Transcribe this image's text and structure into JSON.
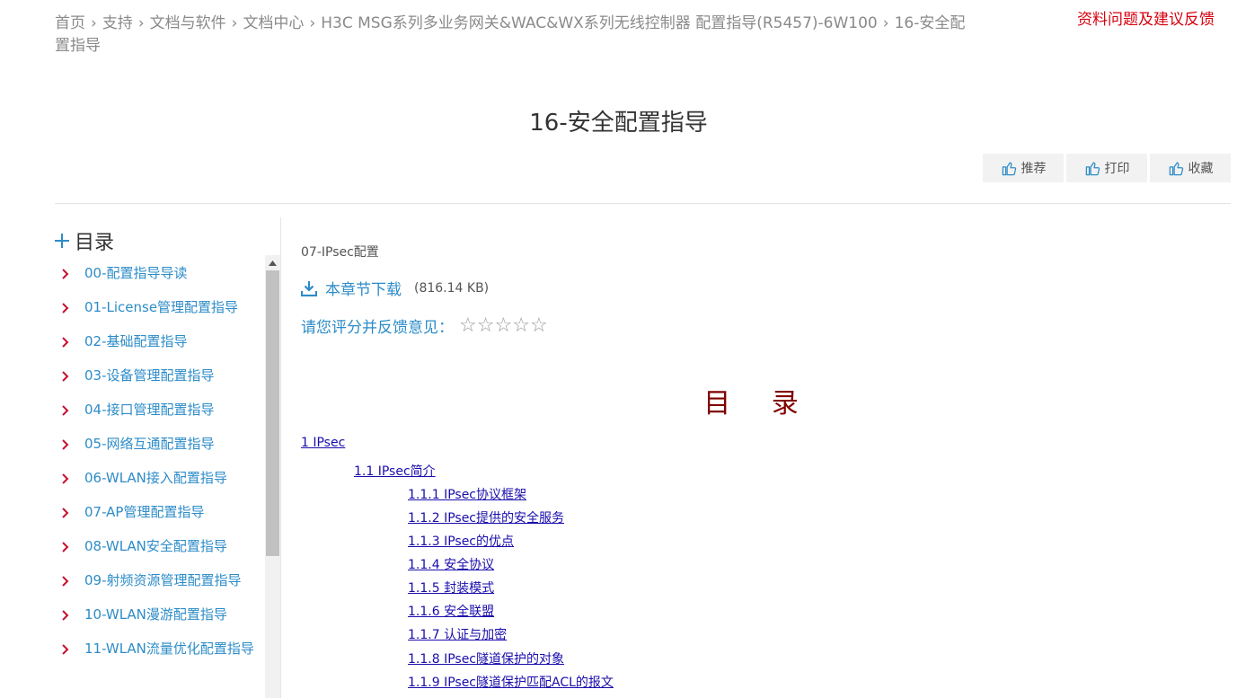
{
  "breadcrumb": {
    "items": [
      "首页",
      "支持",
      "文档与软件",
      "文档中心",
      "H3C MSG系列多业务网关&WAC&WX系列无线控制器 配置指导(R5457)-6W100",
      "16-安全配置指导"
    ],
    "separator": "›"
  },
  "feedback_link": "资料问题及建议反馈",
  "page_title": "16-安全配置指导",
  "actions": [
    {
      "label": "推荐",
      "icon": "thumbs-up-icon"
    },
    {
      "label": "打印",
      "icon": "thumbs-up-icon"
    },
    {
      "label": "收藏",
      "icon": "thumbs-up-icon"
    }
  ],
  "toc": {
    "title": "目录",
    "items": [
      "00-配置指导导读",
      "01-License管理配置指导",
      "02-基础配置指导",
      "03-设备管理配置指导",
      "04-接口管理配置指导",
      "05-网络互通配置指导",
      "06-WLAN接入配置指导",
      "07-AP管理配置指导",
      "08-WLAN安全配置指导",
      "09-射频资源管理配置指导",
      "10-WLAN漫游配置指导",
      "11-WLAN流量优化配置指导"
    ]
  },
  "content": {
    "chapter_name": "07-IPsec配置",
    "download_label": "本章节下载",
    "file_size": "(816.14 KB)",
    "rating_label": "请您评分并反馈意见：",
    "rating_stars": 5,
    "doc_title": "目 录",
    "doc_toc": [
      {
        "text": "1 IPsec",
        "level": 0
      },
      {
        "text": "1.1 IPsec简介",
        "level": 1
      },
      {
        "text": "1.1.1 IPsec协议框架",
        "level": 2
      },
      {
        "text": "1.1.2 IPsec提供的安全服务",
        "level": 2
      },
      {
        "text": "1.1.3 IPsec的优点",
        "level": 2
      },
      {
        "text": "1.1.4 安全协议",
        "level": 2
      },
      {
        "text": "1.1.5 封装模式",
        "level": 2
      },
      {
        "text": "1.1.6 安全联盟",
        "level": 2
      },
      {
        "text": "1.1.7 认证与加密",
        "level": 2
      },
      {
        "text": "1.1.8 IPsec隧道保护的对象",
        "level": 2
      },
      {
        "text": "1.1.9 IPsec隧道保护匹配ACL的报文",
        "level": 2
      }
    ]
  },
  "colors": {
    "link_blue": "#2d8cc8",
    "chevron_red": "#c8102e",
    "feedback_red": "#d7000f",
    "doc_title_red": "#800000",
    "doc_link": "#1a0dab"
  }
}
